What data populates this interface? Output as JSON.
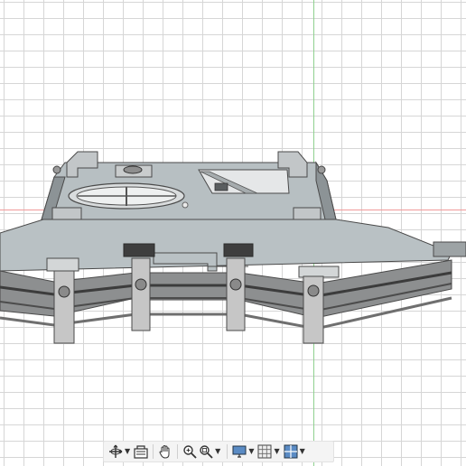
{
  "viewport": {
    "grid": true,
    "background_color": "#ffffff",
    "grid_color": "#d6d6d6",
    "y_axis_color": "#8fd18f",
    "x_axis_color": "#f19a9a"
  },
  "model": {
    "body_color": "#b9c1c4",
    "edge_color": "#4a4a4a",
    "clip_color": "#c6c6c6"
  },
  "toolbar": {
    "buttons": [
      {
        "name": "orbit-button",
        "icon": "orbit-icon",
        "has_dropdown": true
      },
      {
        "name": "look-at-button",
        "icon": "look-at-icon",
        "has_dropdown": false
      },
      {
        "name": "pan-button",
        "icon": "hand-icon",
        "has_dropdown": false
      },
      {
        "name": "zoom-button",
        "icon": "zoom-icon",
        "has_dropdown": false
      },
      {
        "name": "fit-button",
        "icon": "fit-icon",
        "has_dropdown": true
      },
      {
        "name": "display-settings-button",
        "icon": "monitor-icon",
        "has_dropdown": true
      },
      {
        "name": "grid-snaps-button",
        "icon": "grid-icon",
        "has_dropdown": true
      },
      {
        "name": "viewports-button",
        "icon": "viewports-icon",
        "has_dropdown": true
      }
    ]
  }
}
